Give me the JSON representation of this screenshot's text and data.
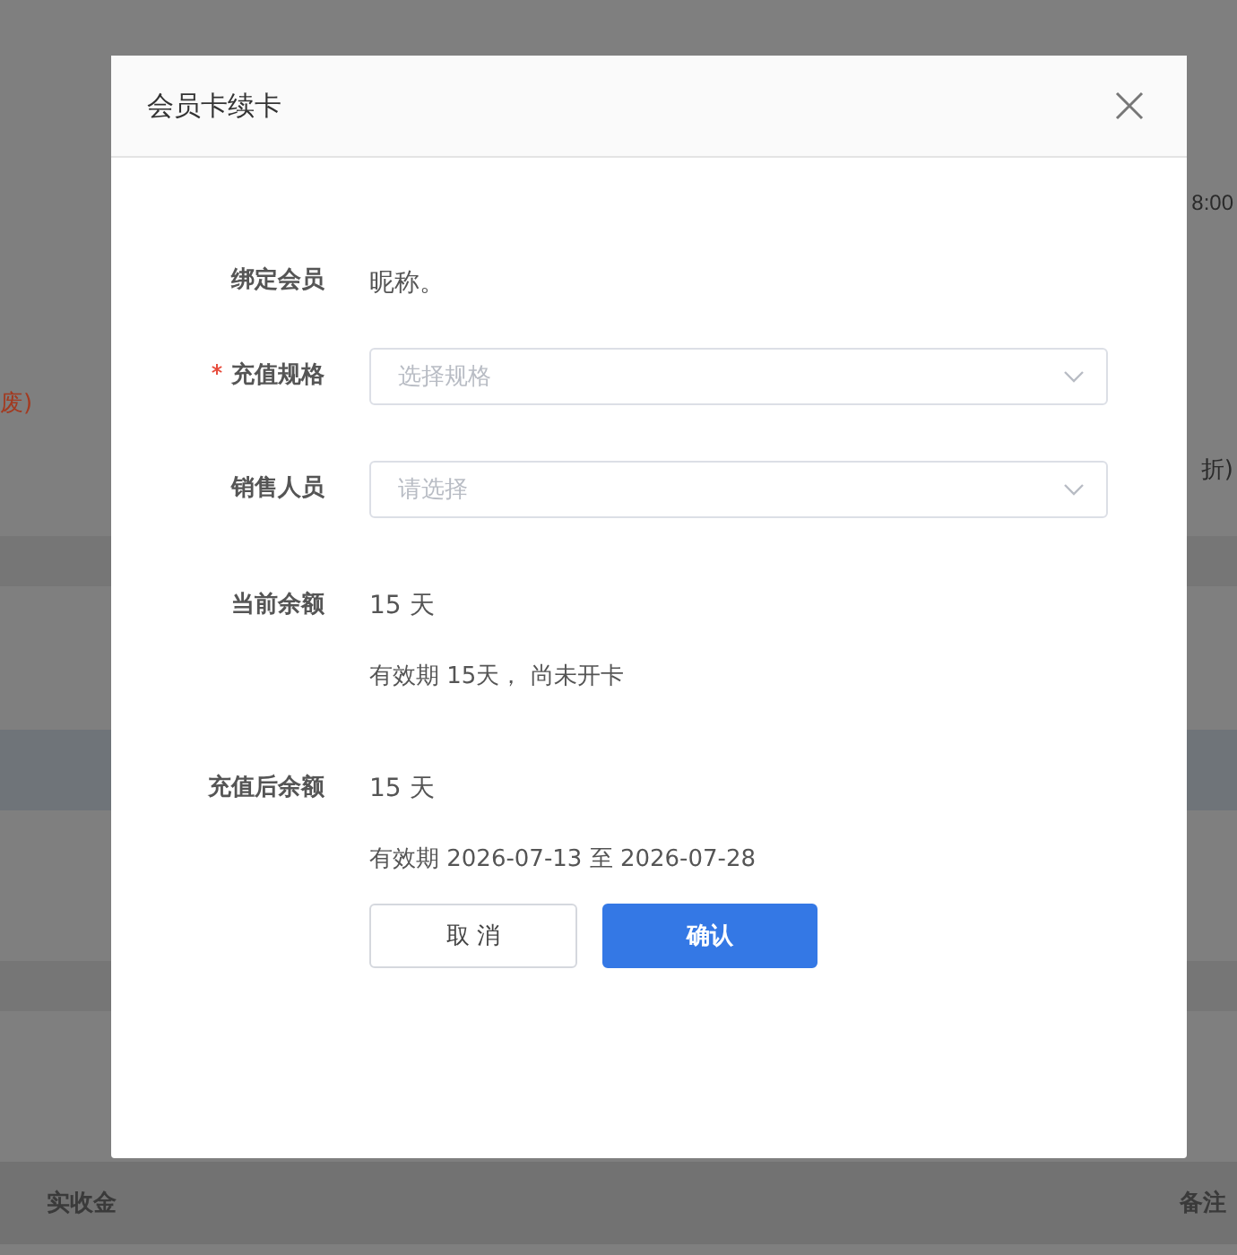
{
  "background": {
    "time_fragment": "8:00",
    "status_fragment": "废)",
    "discount_fragment": "折)",
    "table_headers": [
      "实收金",
      "备注"
    ]
  },
  "dialog": {
    "title": "会员卡续卡",
    "fields": [
      {
        "kind": "text",
        "label": "绑定会员",
        "required": false,
        "value": "昵称。"
      },
      {
        "kind": "select",
        "label": "充值规格",
        "required": true,
        "placeholder": "选择规格"
      },
      {
        "kind": "select",
        "label": "销售人员",
        "required": false,
        "placeholder": "请选择"
      },
      {
        "kind": "balance",
        "label": "当前余额",
        "required": false,
        "value": "15 天",
        "note": "有效期 15天， 尚未开卡"
      },
      {
        "kind": "balance",
        "label": "充值后余额",
        "required": false,
        "value": "15 天",
        "note": "有效期 2026-07-13 至 2026-07-28"
      }
    ],
    "buttons": [
      {
        "kind": "secondary",
        "label": "取 消"
      },
      {
        "kind": "primary",
        "label": "确认"
      }
    ]
  }
}
